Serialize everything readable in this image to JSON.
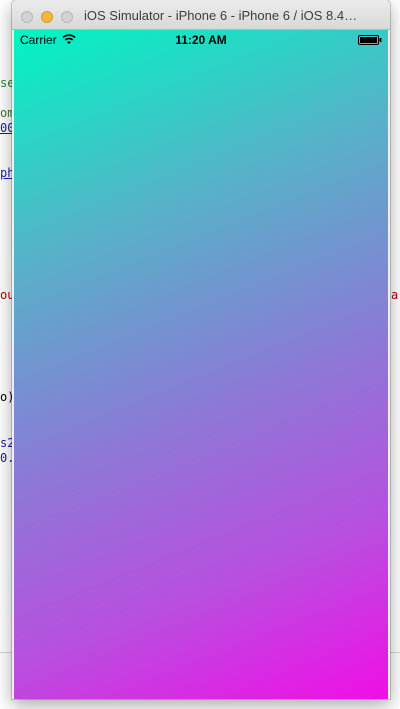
{
  "background_editor": {
    "left_fragments": [
      {
        "text": "se",
        "color": "#2e7d32"
      },
      {
        "text": "om",
        "color": "#2e7d32"
      },
      {
        "text": "00",
        "color": "#1a1aa6"
      },
      {
        "text": "ph",
        "color": "#1a1aa6"
      },
      {
        "text": "ou",
        "color": "#b00000"
      },
      {
        "text": "o)",
        "color": "#000000"
      },
      {
        "text": "s2",
        "color": "#1a1aa6"
      },
      {
        "text": "0.",
        "color": "#1a1aa6"
      }
    ],
    "right_fragments": [
      {
        "text": "a",
        "color": "#b00000"
      }
    ]
  },
  "window": {
    "title": "iOS Simulator - iPhone 6 - iPhone 6 / iOS 8.4…"
  },
  "status_bar": {
    "carrier": "Carrier",
    "time": "11:20 AM",
    "wifi_icon": "wifi-icon",
    "battery_icon": "battery-icon"
  },
  "screen": {
    "gradient_colors": [
      "#00f5c3",
      "#55b3c8",
      "#8b7ad6",
      "#b84fdf",
      "#f00ee6"
    ]
  }
}
